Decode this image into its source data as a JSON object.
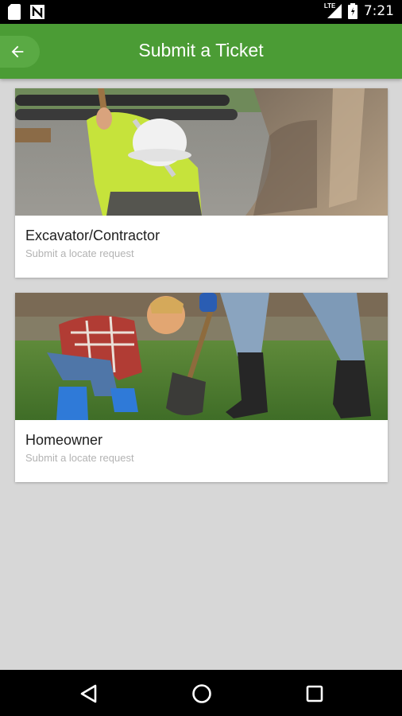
{
  "status_bar": {
    "time": "7:21",
    "network": "LTE",
    "icons": [
      "sd-card-icon",
      "notification-n-icon",
      "lte-signal-icon",
      "battery-icon"
    ]
  },
  "app_bar": {
    "title": "Submit a Ticket",
    "back_icon": "arrow-left-icon"
  },
  "cards": [
    {
      "title": "Excavator/Contractor",
      "subtitle": "Submit a locate request",
      "image": "worker-digging-with-excavator-photo"
    },
    {
      "title": "Homeowner",
      "subtitle": "Submit a locate request",
      "image": "child-digging-with-shovel-photo"
    }
  ],
  "nav_bar": {
    "buttons": [
      "back-triangle-icon",
      "home-circle-icon",
      "recents-square-icon"
    ]
  },
  "colors": {
    "app_bar": "#4b9c35",
    "background": "#d7d7d7",
    "card": "#ffffff"
  }
}
